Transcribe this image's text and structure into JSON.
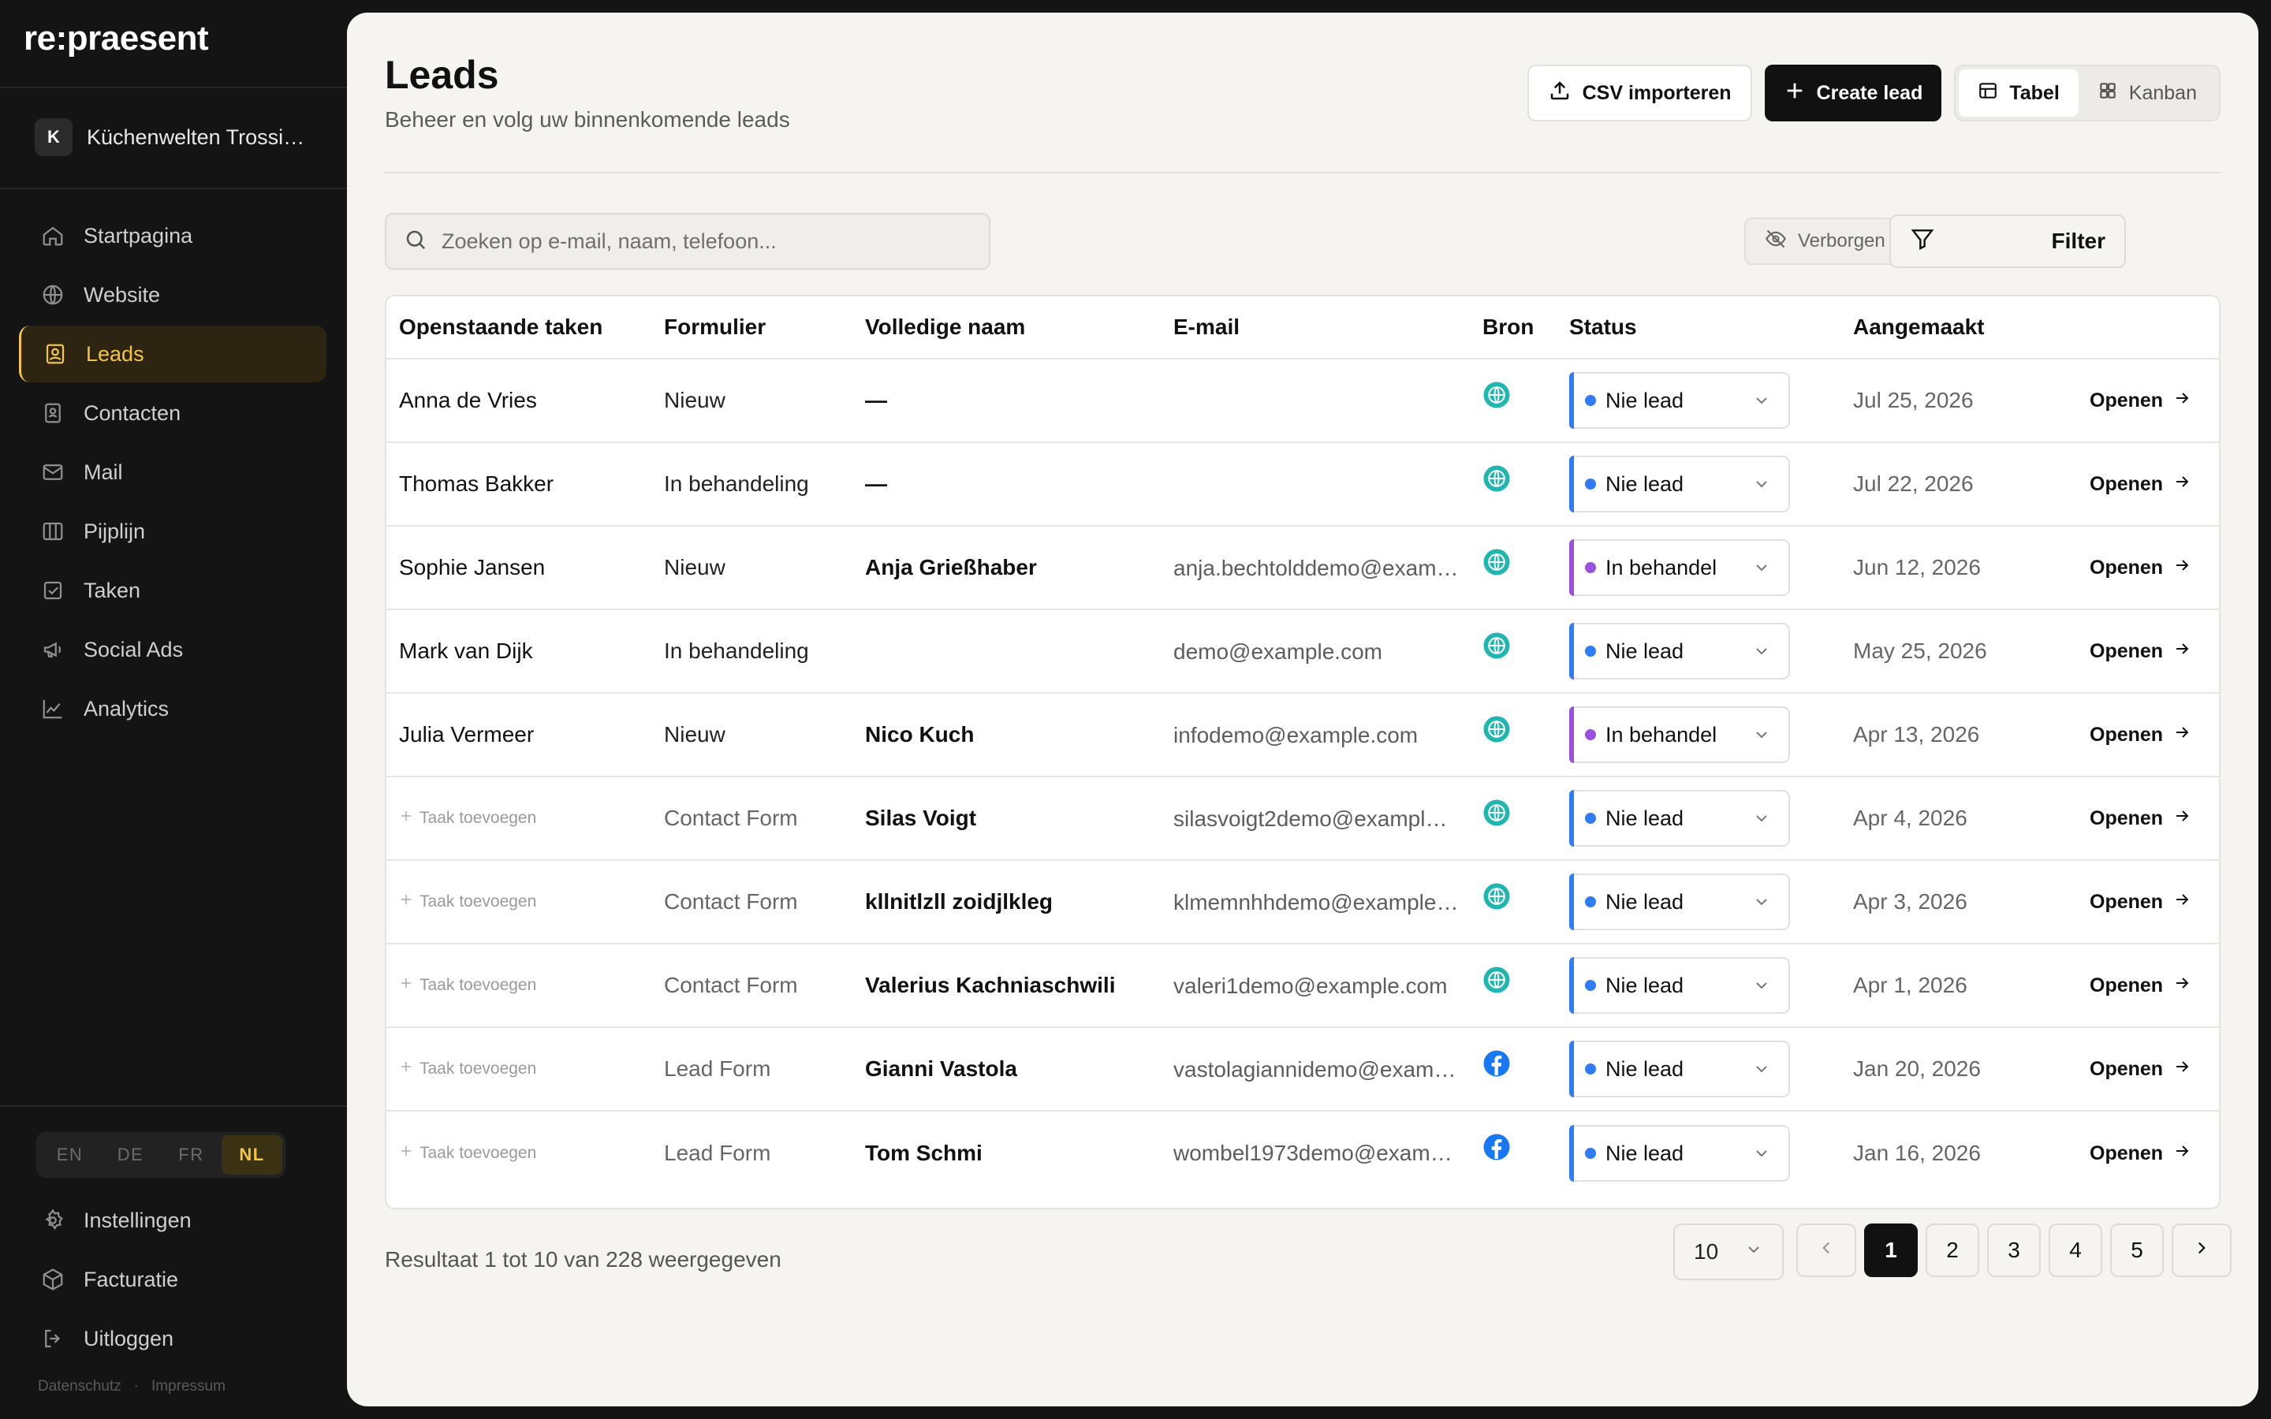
{
  "sidebar": {
    "logo": "re:praesent",
    "workspace": {
      "initial": "K",
      "name": "Küchenwelten Trossin…"
    },
    "nav": [
      {
        "label": "Startpagina",
        "icon": "home-icon"
      },
      {
        "label": "Website",
        "icon": "globe-icon"
      },
      {
        "label": "Leads",
        "icon": "contact-card-icon",
        "active": true
      },
      {
        "label": "Contacten",
        "icon": "address-book-icon"
      },
      {
        "label": "Mail",
        "icon": "mail-icon"
      },
      {
        "label": "Pijplijn",
        "icon": "columns-icon"
      },
      {
        "label": "Taken",
        "icon": "checkbox-icon"
      },
      {
        "label": "Social Ads",
        "icon": "megaphone-icon"
      },
      {
        "label": "Analytics",
        "icon": "line-chart-icon"
      }
    ],
    "languages": [
      "EN",
      "DE",
      "FR",
      "NL"
    ],
    "active_language": "NL",
    "bottom_nav": [
      {
        "label": "Instellingen",
        "icon": "gear-icon"
      },
      {
        "label": "Facturatie",
        "icon": "box-icon"
      },
      {
        "label": "Uitloggen",
        "icon": "logout-icon"
      }
    ],
    "footer": {
      "privacy": "Datenschutz",
      "separator": "·",
      "imprint": "Impressum"
    }
  },
  "header": {
    "title": "Leads",
    "subtitle": "Beheer en volg uw binnenkomende leads",
    "import_label": "CSV importeren",
    "create_label": "Create lead",
    "view_table": "Tabel",
    "view_kanban": "Kanban"
  },
  "toolbar": {
    "search_placeholder": "Zoeken op e-mail, naam, telefoon...",
    "hidden_label": "Verborgen tonen",
    "filter_label": "Filter"
  },
  "table": {
    "columns": [
      "Openstaande taken",
      "Formulier",
      "Volledige naam",
      "E-mail",
      "Bron",
      "Status",
      "Aangemaakt"
    ],
    "open_label": "Openen",
    "add_task_label": "Taak toevoegen",
    "rows": [
      {
        "task": "Anna de Vries",
        "form": "Nieuw",
        "name": "—",
        "email": "",
        "source": "web",
        "status": "Nie lead",
        "status_color": "#2f7cf6",
        "created": "Jul 25, 2026"
      },
      {
        "task": "Thomas Bakker",
        "form": "In behandeling",
        "name": "—",
        "email": "",
        "source": "web",
        "status": "Nie lead",
        "status_color": "#2f7cf6",
        "created": "Jul 22, 2026"
      },
      {
        "task": "Sophie Jansen",
        "form": "Nieuw",
        "name": "Anja Grießhaber",
        "email": "anja.bechtolddemo@exam…",
        "source": "web",
        "status": "In behandel",
        "status_color": "#9b51e0",
        "created": "Jun 12, 2026"
      },
      {
        "task": "Mark van Dijk",
        "form": "In behandeling",
        "name": "",
        "email": "demo@example.com",
        "source": "web",
        "status": "Nie lead",
        "status_color": "#2f7cf6",
        "created": "May 25, 2026"
      },
      {
        "task": "Julia Vermeer",
        "form": "Nieuw",
        "name": "Nico Kuch",
        "email": "infodemo@example.com",
        "source": "web",
        "status": "In behandel",
        "status_color": "#9b51e0",
        "created": "Apr 13, 2026"
      },
      {
        "task": "",
        "form": "Contact Form",
        "name": "Silas Voigt",
        "email": "silasvoigt2demo@example…",
        "source": "web",
        "status": "Nie lead",
        "status_color": "#2f7cf6",
        "created": "Apr 4, 2026"
      },
      {
        "task": "",
        "form": "Contact Form",
        "name": "kllnitlzll zoidjlkleg",
        "email": "klmemnhhdemo@example…",
        "source": "web",
        "status": "Nie lead",
        "status_color": "#2f7cf6",
        "created": "Apr 3, 2026"
      },
      {
        "task": "",
        "form": "Contact Form",
        "name": "Valerius Kachniaschwili",
        "email": "valeri1demo@example.com",
        "source": "web",
        "status": "Nie lead",
        "status_color": "#2f7cf6",
        "created": "Apr 1, 2026"
      },
      {
        "task": "",
        "form": "Lead Form",
        "name": "Gianni Vastola",
        "email": "vastolagiannidemo@exam…",
        "source": "facebook",
        "status": "Nie lead",
        "status_color": "#2f7cf6",
        "created": "Jan 20, 2026"
      },
      {
        "task": "",
        "form": "Lead Form",
        "name": "Tom Schmi",
        "email": "wombel1973demo@examp…",
        "source": "facebook",
        "status": "Nie lead",
        "status_color": "#2f7cf6",
        "created": "Jan 16, 2026"
      }
    ]
  },
  "pagination": {
    "results_text": "Resultaat 1 tot 10 van 228 weergegeven",
    "page_size": "10",
    "pages": [
      "1",
      "2",
      "3",
      "4",
      "5"
    ],
    "current_page": "1"
  },
  "colors": {
    "accent": "#f5c542",
    "web_source": "#1fb5b0",
    "facebook_source": "#1877f2",
    "status_blue": "#2f7cf6",
    "status_purple": "#9b51e0"
  }
}
